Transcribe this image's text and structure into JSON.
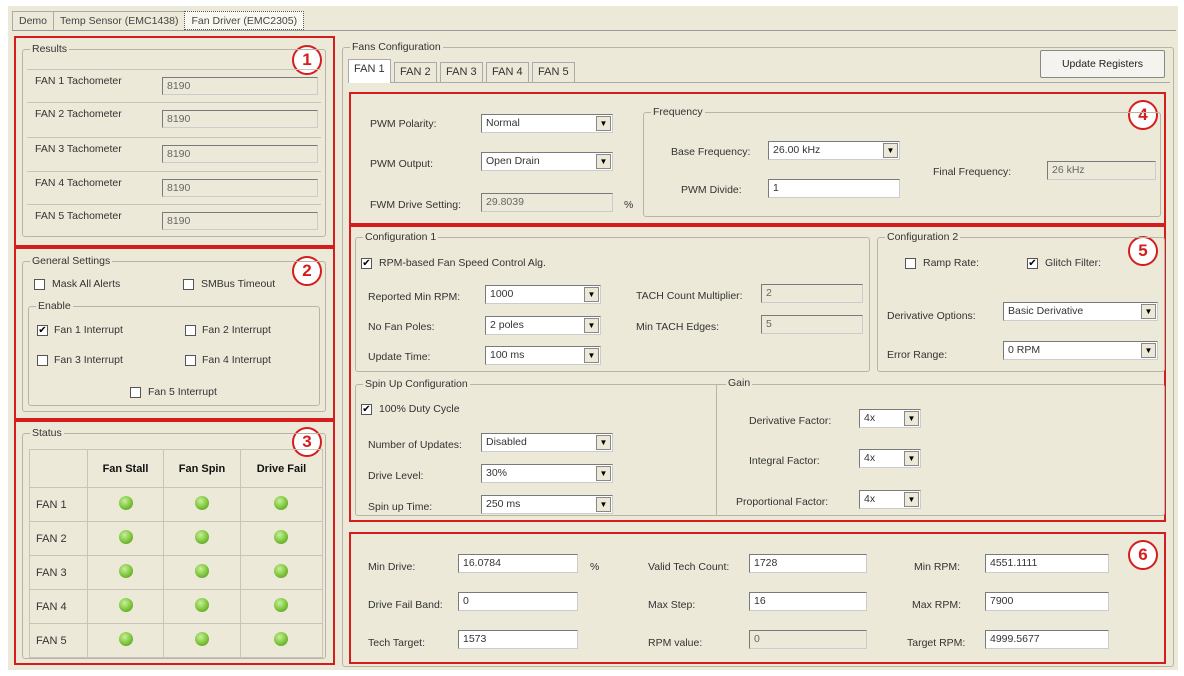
{
  "tabs": [
    "Demo",
    "Temp Sensor (EMC1438)",
    "Fan Driver (EMC2305)"
  ],
  "callouts": [
    "1",
    "2",
    "3",
    "4",
    "5",
    "6"
  ],
  "results": {
    "title": "Results",
    "items": [
      {
        "label": "FAN 1 Tachometer",
        "value": "8190"
      },
      {
        "label": "FAN 2 Tachometer",
        "value": "8190"
      },
      {
        "label": "FAN 3 Tachometer",
        "value": "8190"
      },
      {
        "label": "FAN 4 Tachometer",
        "value": "8190"
      },
      {
        "label": "FAN 5 Tachometer",
        "value": "8190"
      }
    ]
  },
  "general": {
    "title": "General Settings",
    "mask_all_alerts": "Mask All Alerts",
    "smbus_timeout": "SMBus Timeout",
    "enable_title": "Enable",
    "interrupts": [
      "Fan 1 Interrupt",
      "Fan 2 Interrupt",
      "Fan 3 Interrupt",
      "Fan 4 Interrupt",
      "Fan 5 Interrupt"
    ],
    "checked_mark": "✔"
  },
  "status": {
    "title": "Status",
    "columns": [
      "Fan Stall",
      "Fan Spin",
      "Drive Fail"
    ],
    "rows": [
      "FAN 1",
      "FAN 2",
      "FAN 3",
      "FAN 4",
      "FAN 5"
    ],
    "led_color": "#7cc43a"
  },
  "fans": {
    "title": "Fans Configuration",
    "tabs": [
      "FAN 1",
      "FAN 2",
      "FAN 3",
      "FAN 4",
      "FAN 5"
    ],
    "update_button": "Update Registers",
    "pwm_polarity_label": "PWM Polarity:",
    "pwm_polarity": "Normal",
    "pwm_output_label": "PWM Output:",
    "pwm_output": "Open Drain",
    "pwm_drive_label": "FWM Drive Setting:",
    "pwm_drive": "29.8039",
    "pct": "%",
    "frequency": {
      "title": "Frequency",
      "base_label": "Base Frequency:",
      "base": "26.00 kHz",
      "divide_label": "PWM Divide:",
      "divide": "1",
      "final_label": "Final Frequency:",
      "final": "26 kHz"
    },
    "config1": {
      "title": "Configuration 1",
      "rpm_ctrl": "RPM-based Fan Speed Control Alg.",
      "min_rpm_label": "Reported Min RPM:",
      "min_rpm": "1000",
      "poles_label": "No Fan Poles:",
      "poles": "2 poles",
      "update_label": "Update Time:",
      "update": "100 ms",
      "tach_mult_label": "TACH Count Multiplier:",
      "tach_mult": "2",
      "tach_edges_label": "Min TACH Edges:",
      "tach_edges": "5"
    },
    "config2": {
      "title": "Configuration 2",
      "ramp": "Ramp Rate:",
      "glitch": "Glitch Filter:",
      "deriv_label": "Derivative Options:",
      "deriv": "Basic Derivative",
      "err_label": "Error Range:",
      "err": "0 RPM"
    },
    "spin": {
      "title": "Spin Up Configuration",
      "duty": "100% Duty Cycle",
      "updates_label": "Number of Updates:",
      "updates": "Disabled",
      "drive_label": "Drive Level:",
      "drive": "30%",
      "time_label": "Spin up Time:",
      "time": "250 ms"
    },
    "gain": {
      "title": "Gain",
      "deriv_label": "Derivative Factor:",
      "deriv": "4x",
      "integ_label": "Integral Factor:",
      "integ": "4x",
      "prop_label": "Proportional Factor:",
      "prop": "4x"
    },
    "bottom": {
      "min_drive_label": "Min Drive:",
      "min_drive": "16.0784",
      "pct": "%",
      "drive_fail_label": "Drive Fail Band:",
      "drive_fail": "0",
      "tech_target_label": "Tech Target:",
      "tech_target": "1573",
      "valid_tach_label": "Valid Tech Count:",
      "valid_tach": "1728",
      "max_step_label": "Max Step:",
      "max_step": "16",
      "rpm_value_label": "RPM value:",
      "rpm_value": "0",
      "min_rpm_label": "Min RPM:",
      "min_rpm": "4551.1111",
      "max_rpm_label": "Max RPM:",
      "max_rpm": "7900",
      "target_rpm_label": "Target RPM:",
      "target_rpm": "4999.5677"
    }
  }
}
